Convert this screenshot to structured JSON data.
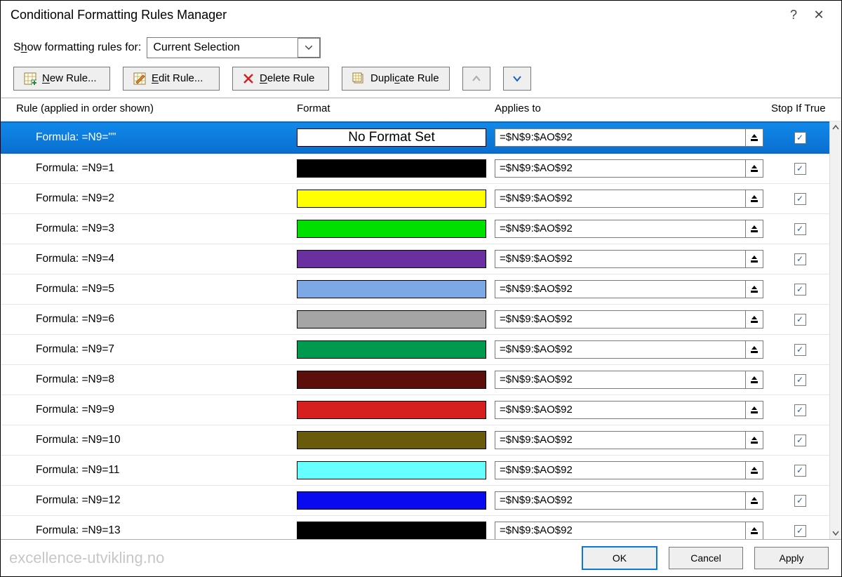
{
  "titlebar": {
    "title": "Conditional Formatting Rules Manager"
  },
  "show_for": {
    "label_pre": "S",
    "label_u": "h",
    "label_post": "ow formatting rules for:",
    "value": "Current Selection"
  },
  "toolbar": {
    "new": "New Rule...",
    "new_u": "N",
    "edit": "Edit Rule...",
    "edit_u": "E",
    "delete": "Delete Rule",
    "delete_u": "D",
    "dup": "Duplicate Rule",
    "dup_u": "c"
  },
  "columns": {
    "rule": "Rule (applied in order shown)",
    "format": "Format",
    "applies": "Applies to",
    "stop": "Stop If True"
  },
  "rules": [
    {
      "name": "Formula: =N9=\"\"",
      "color": null,
      "no_format_text": "No Format Set",
      "applies": "=$N$9:$AO$92",
      "stop": true,
      "selected": true
    },
    {
      "name": "Formula: =N9=1",
      "color": "#000000",
      "applies": "=$N$9:$AO$92",
      "stop": true
    },
    {
      "name": "Formula: =N9=2",
      "color": "#ffff00",
      "applies": "=$N$9:$AO$92",
      "stop": true
    },
    {
      "name": "Formula: =N9=3",
      "color": "#00e000",
      "applies": "=$N$9:$AO$92",
      "stop": true
    },
    {
      "name": "Formula: =N9=4",
      "color": "#6a2fa1",
      "applies": "=$N$9:$AO$92",
      "stop": true
    },
    {
      "name": "Formula: =N9=5",
      "color": "#7da8e6",
      "applies": "=$N$9:$AO$92",
      "stop": true
    },
    {
      "name": "Formula: =N9=6",
      "color": "#a5a5a5",
      "applies": "=$N$9:$AO$92",
      "stop": true
    },
    {
      "name": "Formula: =N9=7",
      "color": "#009a4e",
      "applies": "=$N$9:$AO$92",
      "stop": true
    },
    {
      "name": "Formula: =N9=8",
      "color": "#5b0e0a",
      "applies": "=$N$9:$AO$92",
      "stop": true
    },
    {
      "name": "Formula: =N9=9",
      "color": "#d61f1f",
      "applies": "=$N$9:$AO$92",
      "stop": true
    },
    {
      "name": "Formula: =N9=10",
      "color": "#6a5a0c",
      "applies": "=$N$9:$AO$92",
      "stop": true
    },
    {
      "name": "Formula: =N9=11",
      "color": "#66ffff",
      "applies": "=$N$9:$AO$92",
      "stop": true
    },
    {
      "name": "Formula: =N9=12",
      "color": "#0a0af0",
      "applies": "=$N$9:$AO$92",
      "stop": true
    },
    {
      "name": "Formula: =N9=13",
      "color": "#000000",
      "applies": "=$N$9:$AO$92",
      "stop": true
    }
  ],
  "footer": {
    "ok": "OK",
    "cancel": "Cancel",
    "apply": "Apply",
    "watermark": "excellence-utvikling.no"
  }
}
